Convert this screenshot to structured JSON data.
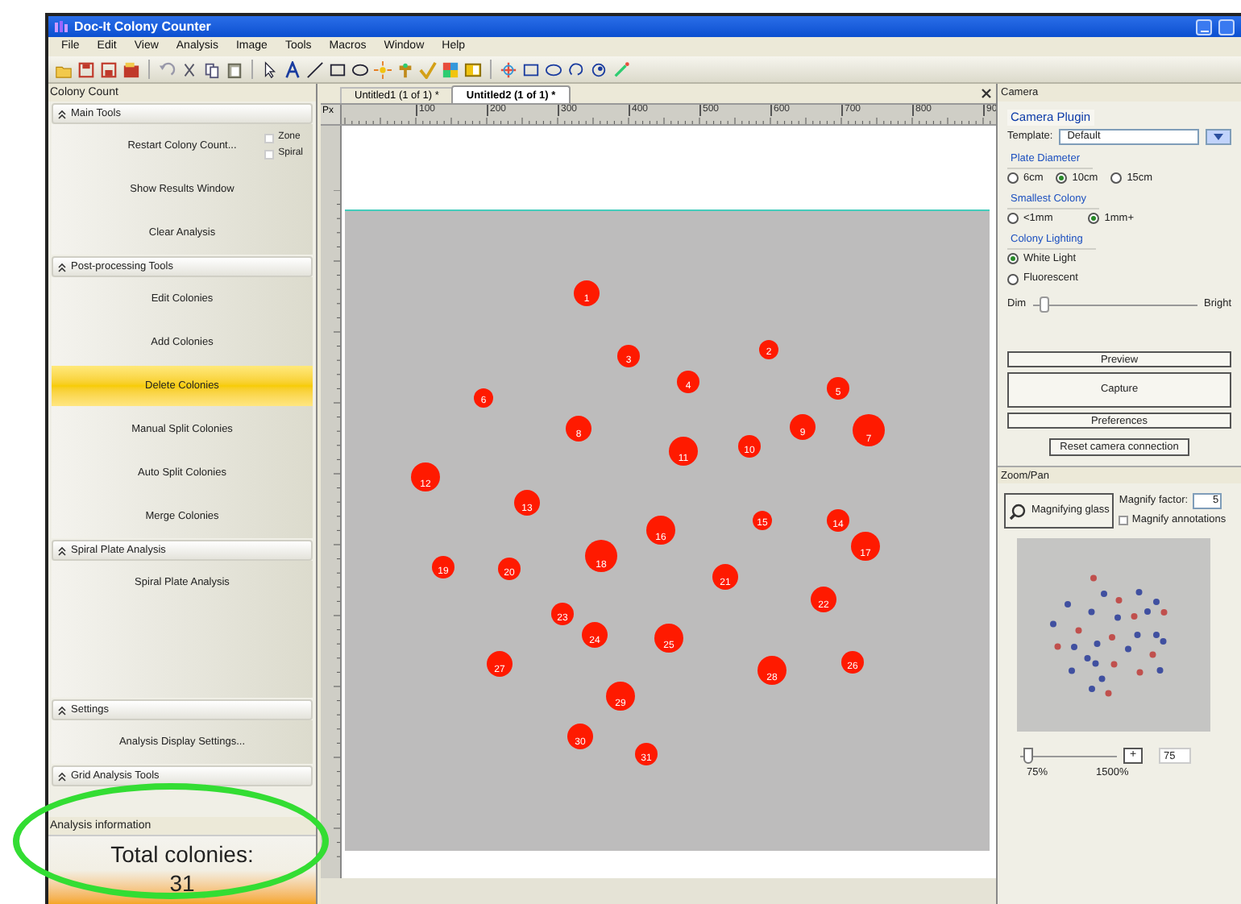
{
  "window": {
    "title": "Doc-It Colony Counter"
  },
  "menu": [
    "File",
    "Edit",
    "View",
    "Analysis",
    "Image",
    "Tools",
    "Macros",
    "Window",
    "Help"
  ],
  "left_panel": {
    "title": "Colony Count",
    "sections": [
      {
        "title": "Main Tools",
        "items": [
          {
            "label": "Restart Colony Count...",
            "selected": false,
            "options": [
              {
                "label": "Zone",
                "checked": false
              },
              {
                "label": "Spiral",
                "checked": false
              }
            ]
          },
          {
            "label": "Show Results Window",
            "selected": false
          },
          {
            "label": "Clear Analysis",
            "selected": false
          }
        ]
      },
      {
        "title": "Post-processing Tools",
        "items": [
          {
            "label": "Edit Colonies",
            "selected": false
          },
          {
            "label": "Add Colonies",
            "selected": false
          },
          {
            "label": "Delete Colonies",
            "selected": true
          },
          {
            "label": "Manual Split Colonies",
            "selected": false
          },
          {
            "label": "Auto Split Colonies",
            "selected": false
          },
          {
            "label": "Merge Colonies",
            "selected": false
          }
        ]
      },
      {
        "title": "Spiral Plate Analysis",
        "items": [
          {
            "label": "Spiral Plate Analysis",
            "selected": false
          }
        ]
      },
      {
        "title": "Settings",
        "items": [
          {
            "label": "Analysis Display Settings...",
            "selected": false
          }
        ]
      },
      {
        "title": "Grid Analysis Tools"
      }
    ],
    "analysis_info": {
      "title": "Analysis information",
      "total_label": "Total colonies:",
      "total_value": "31"
    }
  },
  "document_tabs": [
    {
      "label": "Untitled1 (1 of 1) *",
      "selected": false
    },
    {
      "label": "Untitled2 (1 of 1) *",
      "selected": true
    }
  ],
  "ruler": {
    "unit": "Px",
    "labels": [
      "100",
      "200",
      "300",
      "400",
      "500",
      "600",
      "700",
      "800",
      "90"
    ]
  },
  "colonies": [
    "1",
    "2",
    "3",
    "4",
    "5",
    "6",
    "7",
    "8",
    "9",
    "10",
    "11",
    "12",
    "13",
    "14",
    "15",
    "16",
    "17",
    "18",
    "19",
    "20",
    "21",
    "22",
    "23",
    "24",
    "25",
    "26",
    "27",
    "28",
    "29",
    "30",
    "31"
  ],
  "camera": {
    "title": "Camera",
    "plugin_label": "Camera Plugin",
    "template_label": "Template:",
    "template_value": "Default",
    "groups": [
      {
        "title": "Plate Diameter",
        "options": [
          {
            "label": "6cm",
            "selected": false
          },
          {
            "label": "10cm",
            "selected": true
          },
          {
            "label": "15cm",
            "selected": false
          }
        ]
      },
      {
        "title": "Smallest Colony",
        "options": [
          {
            "label": "<1mm",
            "selected": false
          },
          {
            "label": "1mm+",
            "selected": true
          }
        ]
      },
      {
        "title": "Colony Lighting",
        "options": [
          {
            "label": "White Light",
            "selected": true
          },
          {
            "label": "Fluorescent",
            "selected": false
          }
        ]
      }
    ],
    "brightness": {
      "min_label": "Dim",
      "max_label": "Bright",
      "level": 0.05
    },
    "buttons": [
      "Preview",
      "Capture",
      "Preferences"
    ],
    "reset_button": "Reset camera connection"
  },
  "zoom_pan": {
    "title": "Zoom/Pan",
    "magnifier_button": "Magnifying glass",
    "factor_label": "Magnify factor:",
    "factor_value": "5",
    "annotations": {
      "label": "Magnify annotations",
      "checked": false
    },
    "zoom": {
      "level": 0.04,
      "min_label": "75%",
      "max_label": "1500%",
      "plus": "+",
      "value": "75"
    }
  }
}
